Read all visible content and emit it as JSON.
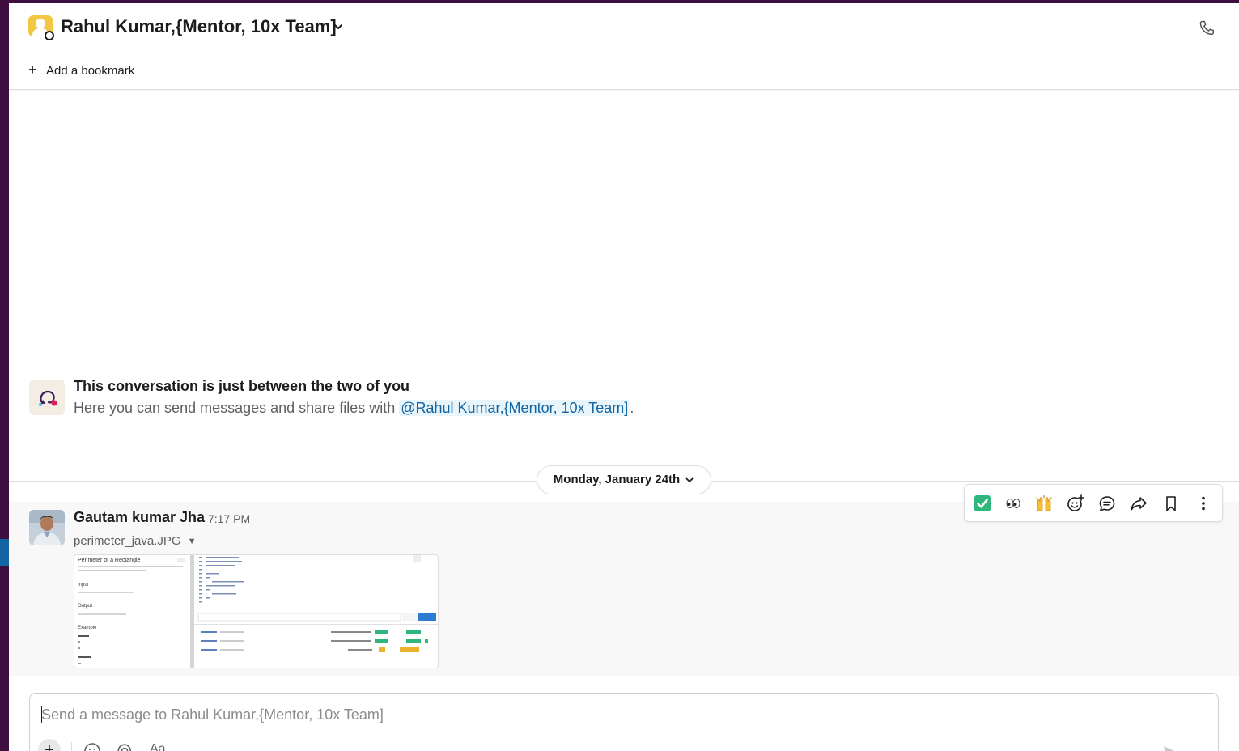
{
  "header": {
    "title": "Rahul Kumar,{Mentor, 10x Team]"
  },
  "bookmarks": {
    "add_label": "Add a bookmark"
  },
  "intro": {
    "title": "This conversation is just between the two of you",
    "text_prefix": "Here you can send messages and share files with ",
    "mention": "@Rahul Kumar,{Mentor, 10x Team]",
    "text_suffix": "."
  },
  "divider": {
    "date_label": "Monday, January 24th"
  },
  "message": {
    "author": "Gautam kumar Jha",
    "time": "7:17 PM",
    "file_name": "perimeter_java.JPG",
    "thumbnail": {
      "heading": "Perimeter of a Rectangle",
      "sections": [
        "Input",
        "Output",
        "Example"
      ]
    }
  },
  "toolbar": {
    "icons": [
      "white-check-mark-emoji",
      "eyes-emoji",
      "raised-hands-emoji",
      "add-reaction-icon",
      "reply-in-thread-icon",
      "share-icon",
      "save-icon",
      "more-actions-icon"
    ]
  },
  "composer": {
    "placeholder": "Send a message to Rahul Kumar,{Mentor, 10x Team]",
    "format_label": "Aa"
  },
  "colors": {
    "sidebar": "#3f0e40",
    "mention": "#1264a3",
    "mention_bg": "#e8f5fa",
    "avatar_yellow": "#f2c744",
    "check_green": "#2eb67d"
  }
}
